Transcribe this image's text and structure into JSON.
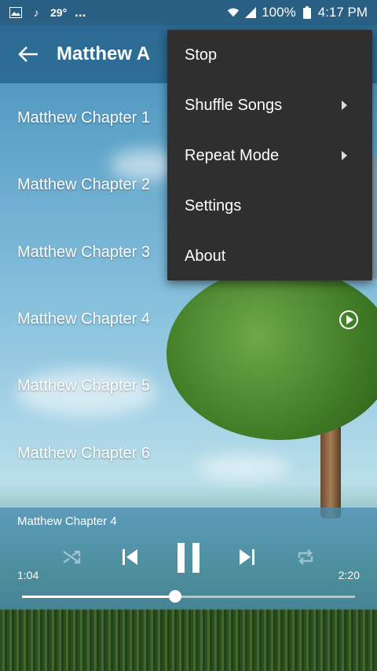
{
  "status_bar": {
    "temperature": "29°",
    "more": "...",
    "battery": "100%",
    "time": "4:17 PM",
    "icons": [
      "image-icon",
      "music-note-icon",
      "wifi-icon",
      "signal-icon",
      "battery-icon"
    ]
  },
  "app_bar": {
    "back_icon": "arrow-back-icon",
    "title": "Matthew A"
  },
  "chapters": [
    {
      "label": "Matthew Chapter 1"
    },
    {
      "label": "Matthew Chapter 2"
    },
    {
      "label": "Matthew Chapter 3"
    },
    {
      "label": "Matthew Chapter 4",
      "playing": true
    },
    {
      "label": "Matthew Chapter 5"
    },
    {
      "label": "Matthew Chapter 6"
    }
  ],
  "menu": {
    "items": [
      {
        "label": "Stop"
      },
      {
        "label": "Shuffle Songs",
        "submenu": true
      },
      {
        "label": "Repeat Mode",
        "submenu": true
      },
      {
        "label": "Settings"
      },
      {
        "label": "About"
      }
    ]
  },
  "player": {
    "now_playing": "Matthew Chapter 4",
    "elapsed": "1:04",
    "duration": "2:20",
    "progress": 0.46,
    "controls": [
      "shuffle-icon",
      "previous-icon",
      "pause-icon",
      "next-icon",
      "repeat-icon"
    ]
  },
  "colors": {
    "menu_bg": "#2f2f2f",
    "player_bg": "#468cb4",
    "appbar_bg": "#235f87"
  }
}
